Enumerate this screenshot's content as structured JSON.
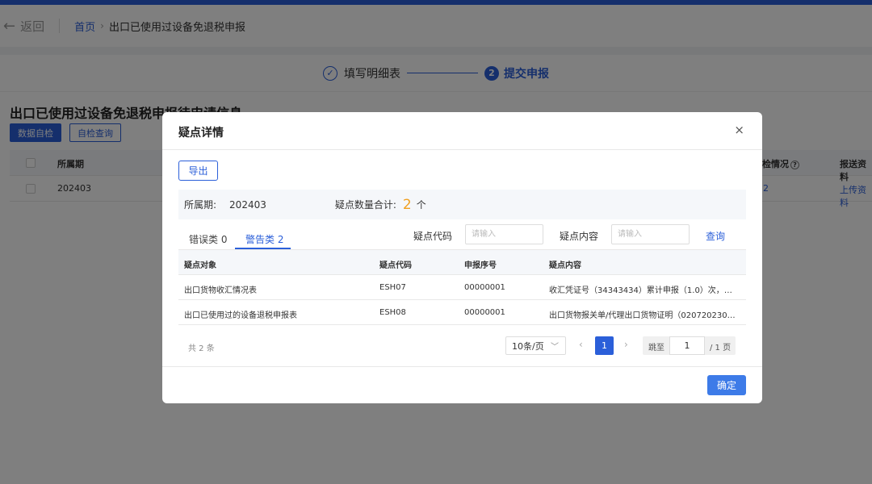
{
  "nav": {
    "back_label": "返回",
    "breadcrumb_home": "首页",
    "breadcrumb_sep": "›",
    "breadcrumb_current": "出口已使用过设备免退税申报"
  },
  "steps": {
    "step1_label": "填写明细表",
    "step1_icon": "check-icon",
    "step2_number": "2",
    "step2_label": "提交申报"
  },
  "background": {
    "section_title": "出口已使用过设备免退税申报待申请信息",
    "btn_self_check": "数据自检",
    "btn_self_check_query": "自检查询",
    "table_headers": {
      "period": "所属期",
      "check_status": "检情况",
      "report_data": "报送资料"
    },
    "row": {
      "period": "202403",
      "check_value": "2",
      "upload_link": "上传资料"
    }
  },
  "modal": {
    "title": "疑点详情",
    "close_symbol": "×",
    "export_label": "导出",
    "summary": {
      "period_label": "所属期:",
      "period_value": "202403",
      "count_label": "疑点数量合计:",
      "count_value": "2",
      "count_unit": "个"
    },
    "tabs": [
      {
        "label": "错误类 0",
        "active": false
      },
      {
        "label": "警告类 2",
        "active": true
      }
    ],
    "filters": {
      "code_label": "疑点代码",
      "code_placeholder": "请输入",
      "content_label": "疑点内容",
      "content_placeholder": "请输入",
      "query_label": "查询"
    },
    "table": {
      "headers": [
        "疑点对象",
        "疑点代码",
        "申报序号",
        "疑点内容"
      ],
      "rows": [
        [
          "出口货物收汇情况表",
          "ESH07",
          "00000001",
          "收汇凭证号（34343434）累计申报（1.0）次，对应..."
        ],
        [
          "出口已使用过的设备退税申报表",
          "ESH08",
          "00000001",
          "出口货物报关单/代理出口货物证明（020720230000..."
        ]
      ]
    },
    "pagination": {
      "total_text": "共 2 条",
      "page_size": "10条/页",
      "prev_symbol": "‹",
      "current_page": "1",
      "next_symbol": "›",
      "jump_label": "跳至",
      "jump_value": "1",
      "total_pages": "/ 1 页"
    },
    "confirm_label": "确定"
  },
  "colors": {
    "primary": "#2b5fd9",
    "warning_count": "#f0a020",
    "confirm": "#3d7be8"
  }
}
